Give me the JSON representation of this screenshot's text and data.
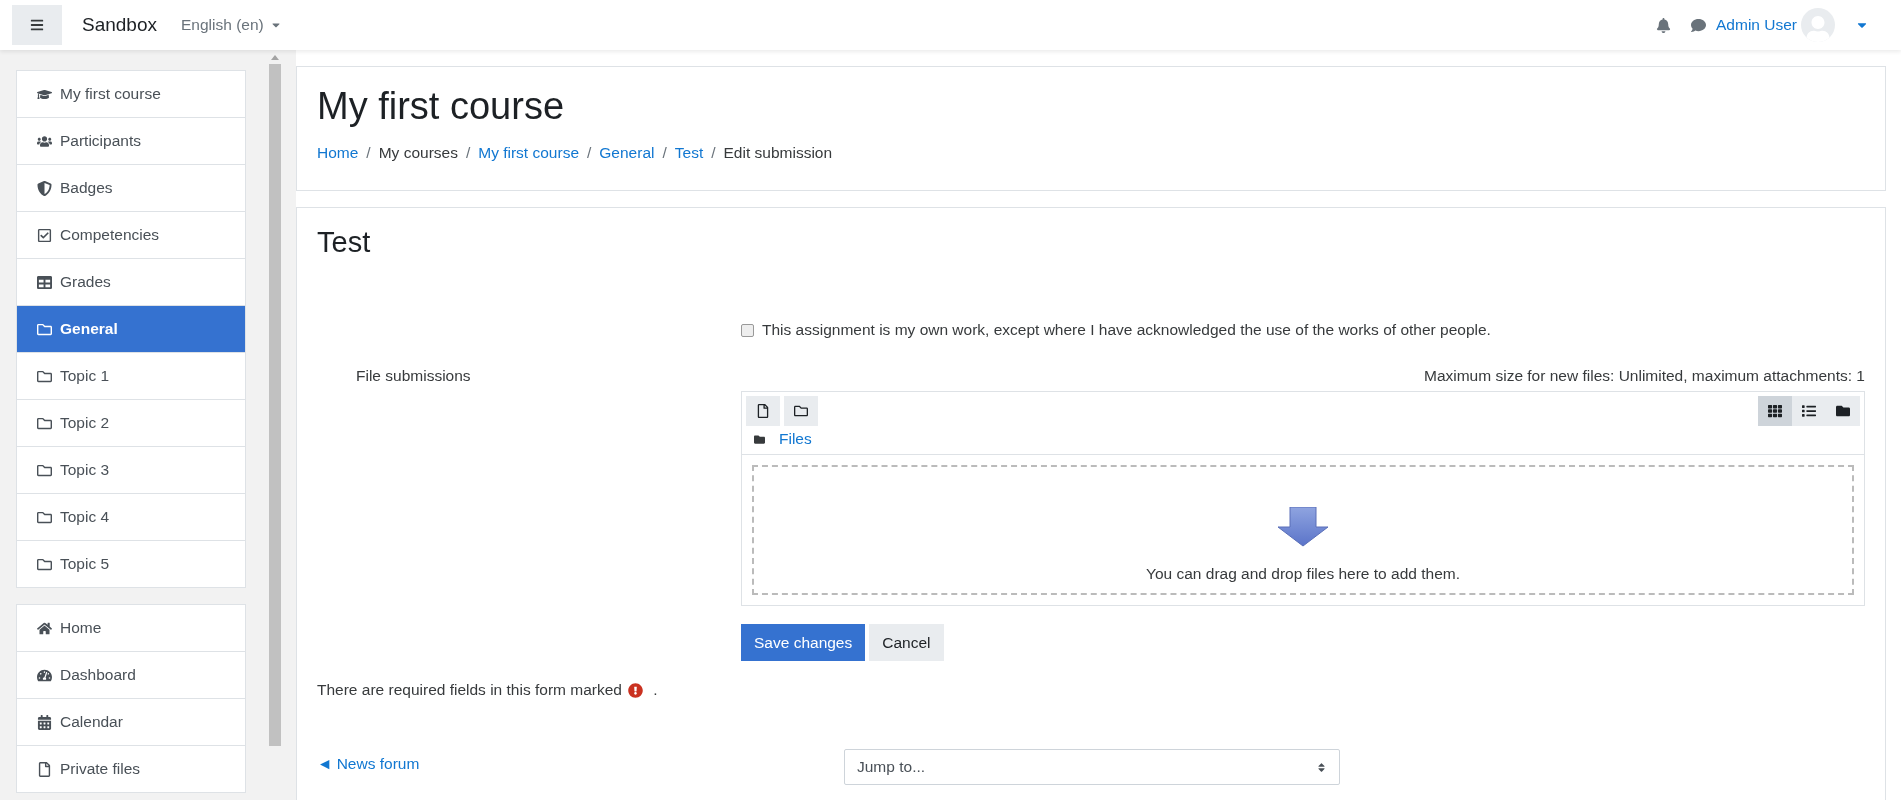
{
  "navbar": {
    "site_name": "Sandbox",
    "language": "English (en)",
    "user_name": "Admin User"
  },
  "sidebar": {
    "course_items": [
      {
        "label": "My first course",
        "kind": "course",
        "selected": false
      },
      {
        "label": "Participants",
        "kind": "participants",
        "selected": false
      },
      {
        "label": "Badges",
        "kind": "badges",
        "selected": false
      },
      {
        "label": "Competencies",
        "kind": "competencies",
        "selected": false
      },
      {
        "label": "Grades",
        "kind": "grades",
        "selected": false
      },
      {
        "label": "General",
        "kind": "section",
        "selected": true
      },
      {
        "label": "Topic 1",
        "kind": "section",
        "selected": false
      },
      {
        "label": "Topic 2",
        "kind": "section",
        "selected": false
      },
      {
        "label": "Topic 3",
        "kind": "section",
        "selected": false
      },
      {
        "label": "Topic 4",
        "kind": "section",
        "selected": false
      },
      {
        "label": "Topic 5",
        "kind": "section",
        "selected": false
      }
    ],
    "site_items": [
      {
        "label": "Home",
        "kind": "home",
        "selected": false
      },
      {
        "label": "Dashboard",
        "kind": "dashboard",
        "selected": false
      },
      {
        "label": "Calendar",
        "kind": "calendar",
        "selected": false
      },
      {
        "label": "Private files",
        "kind": "files",
        "selected": false
      }
    ]
  },
  "header": {
    "title": "My first course",
    "separator": "/",
    "breadcrumbs": [
      {
        "label": "Home",
        "link": true
      },
      {
        "label": "My courses",
        "link": false
      },
      {
        "label": "My first course",
        "link": true
      },
      {
        "label": "General",
        "link": true
      },
      {
        "label": "Test",
        "link": true
      },
      {
        "label": "Edit submission",
        "link": false
      }
    ]
  },
  "form": {
    "title": "Test",
    "statement": {
      "label": "This assignment is my own work, except where I have acknowledged the use of the works of other people.",
      "checked": false
    },
    "file_submissions": {
      "label": "File submissions",
      "limits": "Maximum size for new files: Unlimited, maximum attachments: 1",
      "path": "Files",
      "views": [
        {
          "kind": "icons",
          "selected": true
        },
        {
          "kind": "list",
          "selected": false
        },
        {
          "kind": "tree",
          "selected": false
        }
      ],
      "drop_hint": "You can drag and drop files here to add them."
    },
    "buttons": [
      {
        "label": "Save changes",
        "kind": "primary"
      },
      {
        "label": "Cancel",
        "kind": "secondary"
      }
    ],
    "required_note": "There are required fields in this form marked",
    "required_note_end": "."
  },
  "footer_nav": {
    "previous": "◄ News forum",
    "jump_placeholder": "Jump to..."
  }
}
